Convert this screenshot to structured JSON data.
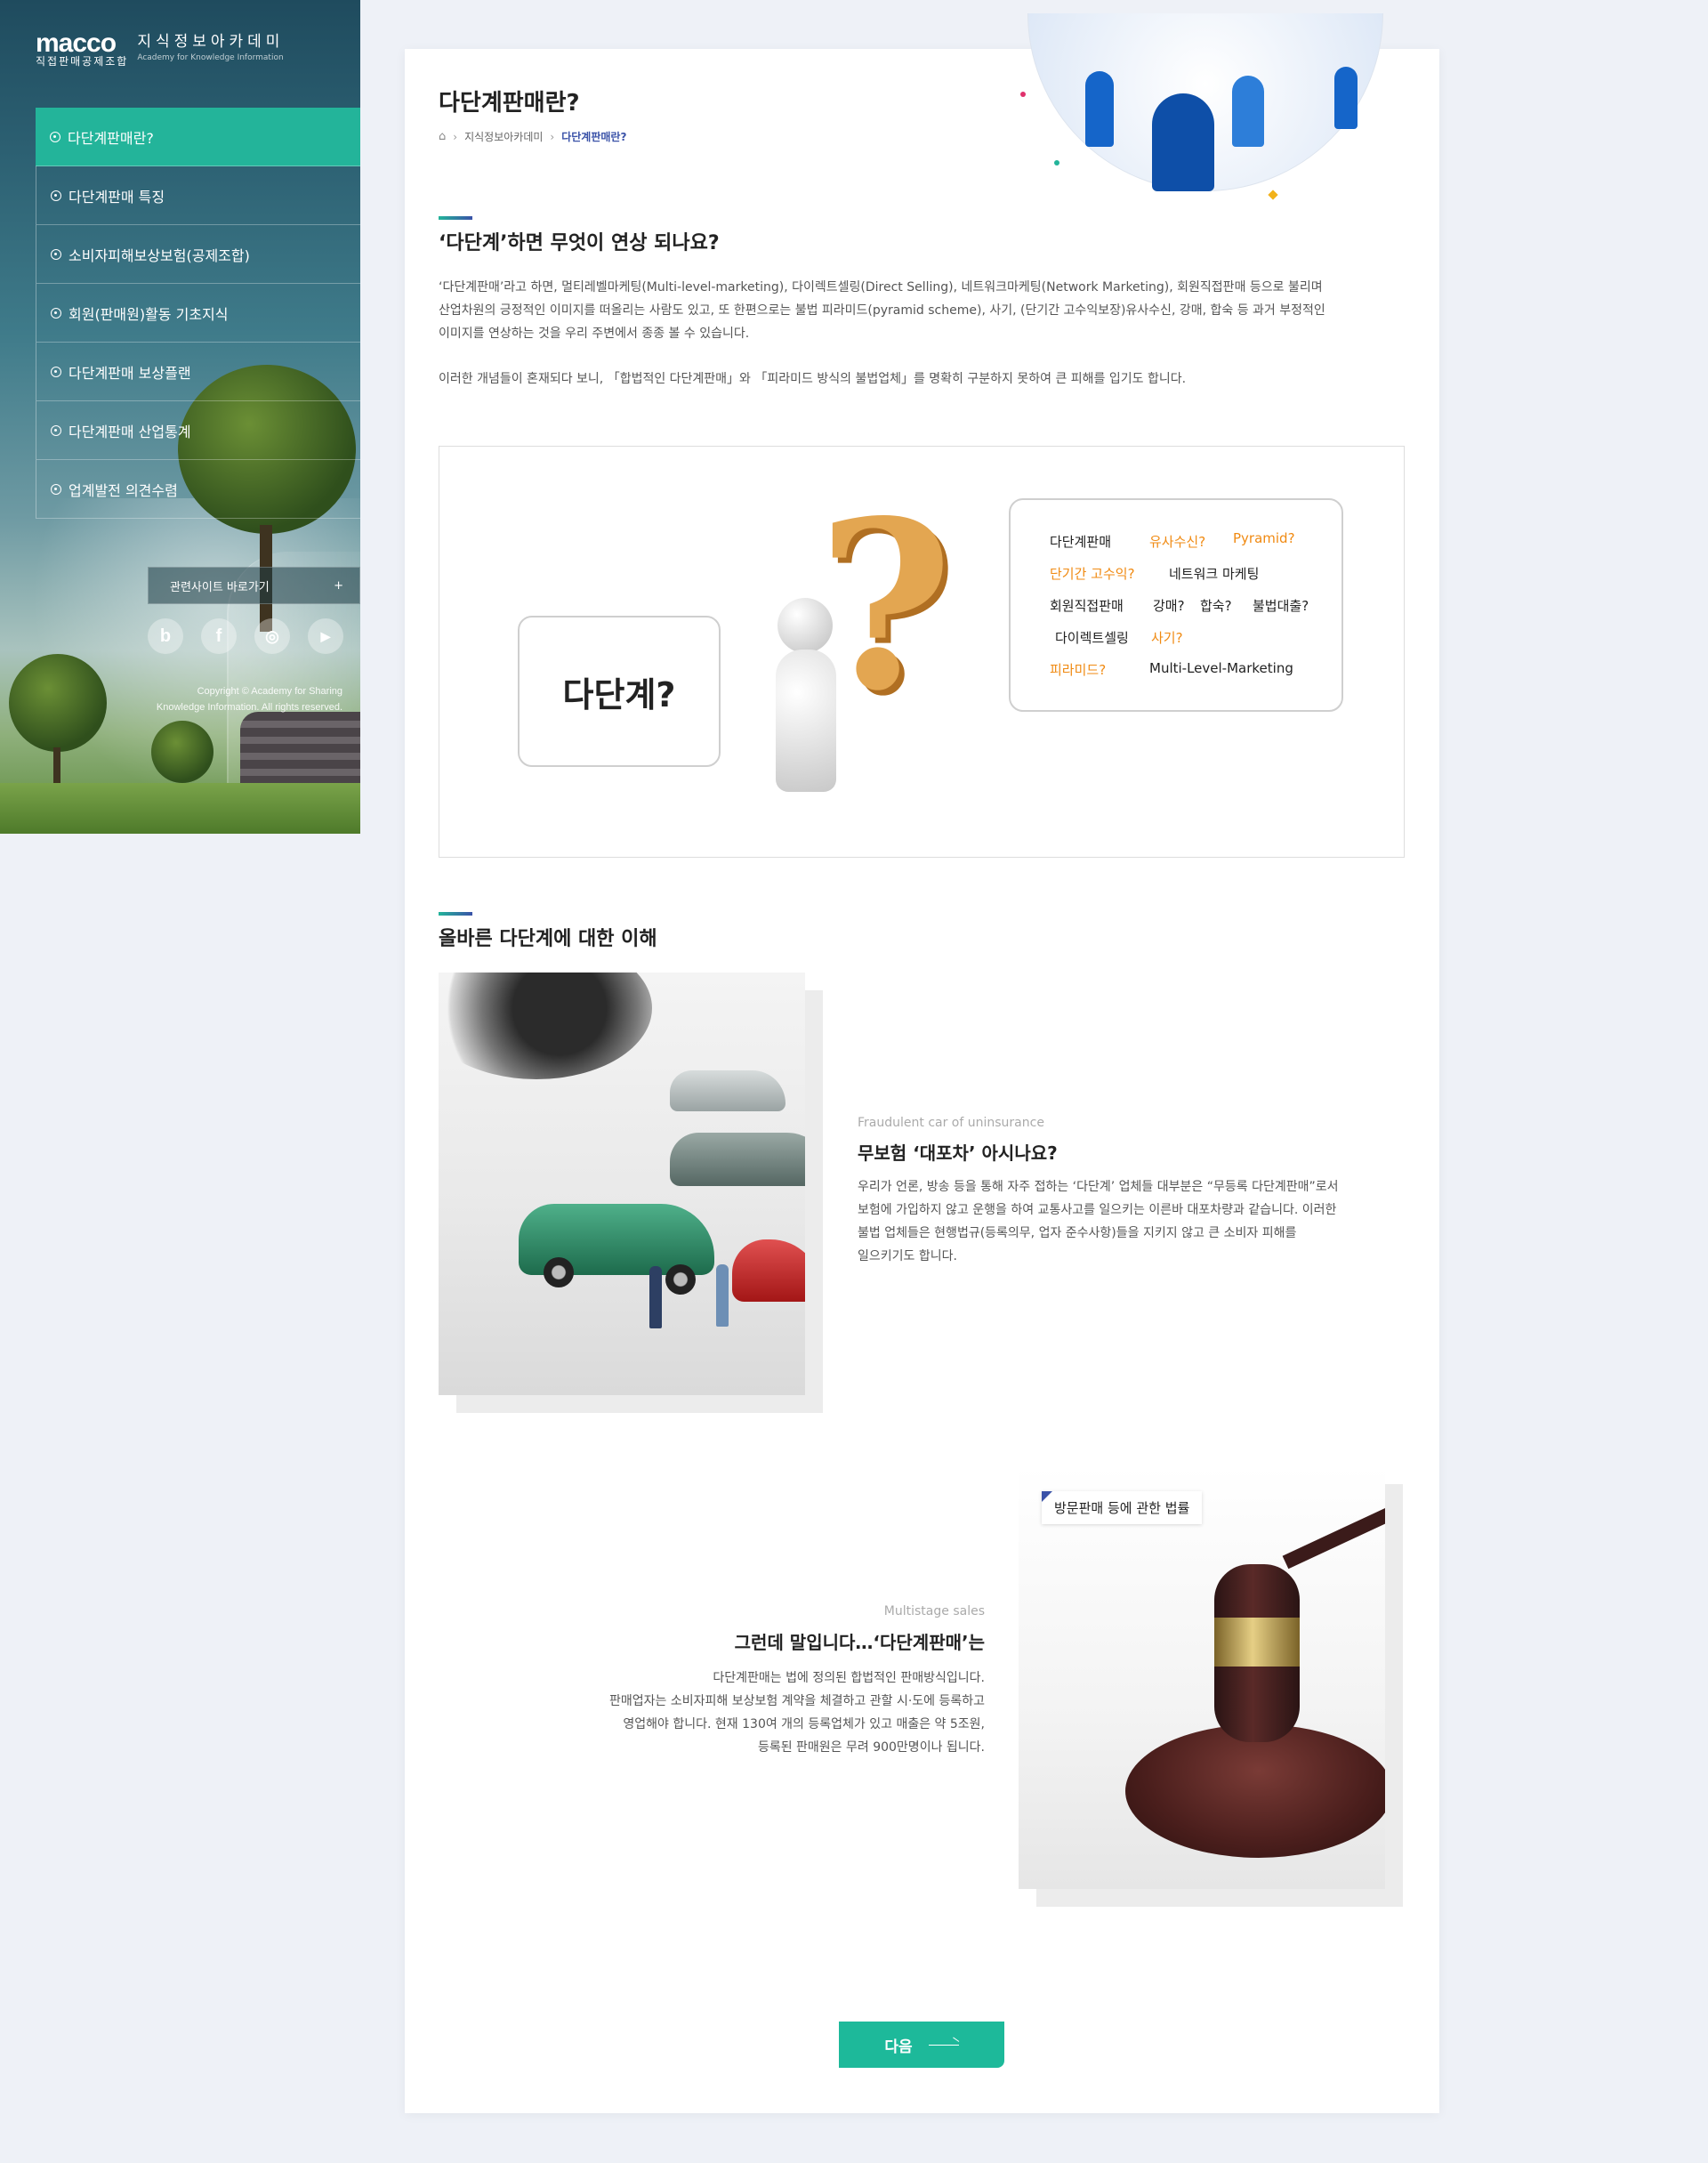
{
  "sidebar": {
    "logo": {
      "mark": "macco",
      "sub": "직접판매공제조합",
      "title": "지식정보아카데미",
      "en": "Academy for Knowledge Information"
    },
    "items": [
      {
        "label": "다단계판매란?",
        "active": true
      },
      {
        "label": "다단계판매 특징",
        "active": false
      },
      {
        "label": "소비자피해보상보험(공제조합)",
        "active": false
      },
      {
        "label": "회원(판매원)활동 기초지식",
        "active": false
      },
      {
        "label": "다단계판매 보상플랜",
        "active": false
      },
      {
        "label": "다단계판매 산업통계",
        "active": false
      },
      {
        "label": "업계발전 의견수렴",
        "active": false
      }
    ],
    "related": {
      "label": "관련사이트 바로가기",
      "icon": "plus"
    },
    "social": [
      {
        "name": "blog",
        "glyph": "b"
      },
      {
        "name": "facebook",
        "glyph": "f"
      },
      {
        "name": "instagram",
        "glyph": "◎"
      },
      {
        "name": "youtube",
        "glyph": "▶"
      }
    ],
    "copyright": {
      "line1": "Copyright © Academy for Sharing",
      "line2": "Knowledge Information. All rights reserved."
    }
  },
  "main": {
    "title": "다단계판매란?",
    "breadcrumb": {
      "parent": "지식정보아카데미",
      "current": "다단계판매란?"
    },
    "section1": {
      "title": "‘다단계’하면 무엇이 연상 되나요?",
      "p1_l1": "‘다단계판매’라고 하면, 멀티레벨마케팅(Multi-level-marketing), 다이렉트셀링(Direct Selling), 네트워크마케팅(Network Marketing), 회원직접판매 등으로 불리며",
      "p1_l2": "산업차원의 긍정적인 이미지를 떠올리는 사람도 있고, 또 한편으로는 불법 피라미드(pyramid scheme), 사기, (단기간 고수익보장)유사수신, 강매, 합숙 등 과거 부정적인",
      "p1_l3": "이미지를 연상하는 것을 우리 주변에서 종종 볼 수 있습니다.",
      "p2": "이러한 개념들이 혼재되다 보니, 「합법적인 다단계판매」와 「피라미드 방식의 불법업체」를 명확히 구분하지 못하여 큰 피해를 입기도 합니다."
    },
    "question_box": {
      "bubble": "다단계?",
      "keywords": {
        "k1": "다단계판매",
        "k2": "유사수신?",
        "k3": "Pyramid?",
        "k4": "단기간 고수익?",
        "k5": "네트워크 마케팅",
        "k6": "회원직접판매",
        "k7": "강매?",
        "k8": "합숙?",
        "k9": "불법대출?",
        "k10": "다이렉트셀링",
        "k11": "사기?",
        "k12": "피라미드?",
        "k13": "Multi-Level-Marketing"
      }
    },
    "section2": {
      "title": "올바른 다단계에 대한 이해",
      "block1": {
        "en": "Fraudulent car of uninsurance",
        "title": "무보험 ‘대포차’ 아시나요?",
        "l1": "우리가 언론, 방송 등을 통해 자주 접하는 ‘다단계’ 업체들 대부분은 “무등록 다단계판매”로서",
        "l2": "보험에 가입하지 않고 운행을 하여 교통사고를 일으키는 이른바 대포차량과 같습니다. 이러한",
        "l3": "불법 업체들은 현행법규(등록의무, 업자 준수사항)들을 지키지 않고 큰 소비자 피해를",
        "l4": "일으키기도 합니다."
      },
      "block2": {
        "en": "Multistage sales",
        "title": "그런데 말입니다…‘다단계판매’는",
        "l1": "다단계판매는 법에 정의된 합법적인 판매방식입니다.",
        "l2": "판매업자는 소비자피해 보상보험 계약을 체결하고 관할 시·도에 등록하고",
        "l3": "영업해야 합니다. 현재 130여 개의 등록업체가 있고 매출은 약 5조원,",
        "l4": "등록된 판매원은 무려 900만명이나 됩니다.",
        "badge": "방문판매 등에 관한 법률"
      }
    },
    "next_label": "다음"
  },
  "colors": {
    "accent": "#1db99a",
    "nav_active": "#23b49a",
    "brand_blue": "#3a52a8",
    "keyword_orange": "#f08a12"
  }
}
